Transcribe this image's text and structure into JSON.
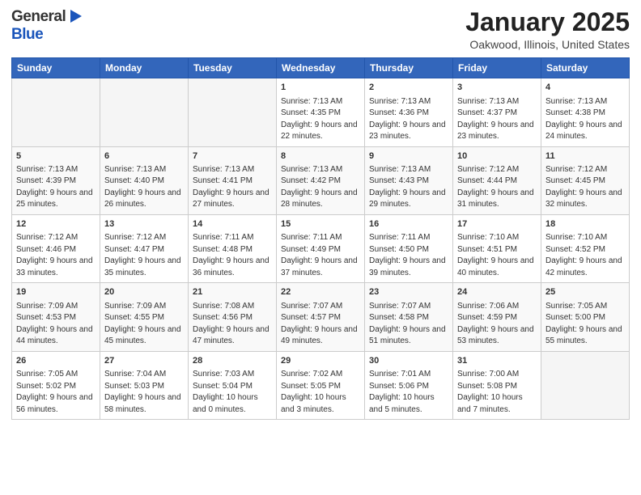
{
  "header": {
    "logo_general": "General",
    "logo_blue": "Blue",
    "title": "January 2025",
    "subtitle": "Oakwood, Illinois, United States"
  },
  "calendar": {
    "days_of_week": [
      "Sunday",
      "Monday",
      "Tuesday",
      "Wednesday",
      "Thursday",
      "Friday",
      "Saturday"
    ],
    "weeks": [
      [
        {
          "day": "",
          "info": ""
        },
        {
          "day": "",
          "info": ""
        },
        {
          "day": "",
          "info": ""
        },
        {
          "day": "1",
          "info": "Sunrise: 7:13 AM\nSunset: 4:35 PM\nDaylight: 9 hours and 22 minutes."
        },
        {
          "day": "2",
          "info": "Sunrise: 7:13 AM\nSunset: 4:36 PM\nDaylight: 9 hours and 23 minutes."
        },
        {
          "day": "3",
          "info": "Sunrise: 7:13 AM\nSunset: 4:37 PM\nDaylight: 9 hours and 23 minutes."
        },
        {
          "day": "4",
          "info": "Sunrise: 7:13 AM\nSunset: 4:38 PM\nDaylight: 9 hours and 24 minutes."
        }
      ],
      [
        {
          "day": "5",
          "info": "Sunrise: 7:13 AM\nSunset: 4:39 PM\nDaylight: 9 hours and 25 minutes."
        },
        {
          "day": "6",
          "info": "Sunrise: 7:13 AM\nSunset: 4:40 PM\nDaylight: 9 hours and 26 minutes."
        },
        {
          "day": "7",
          "info": "Sunrise: 7:13 AM\nSunset: 4:41 PM\nDaylight: 9 hours and 27 minutes."
        },
        {
          "day": "8",
          "info": "Sunrise: 7:13 AM\nSunset: 4:42 PM\nDaylight: 9 hours and 28 minutes."
        },
        {
          "day": "9",
          "info": "Sunrise: 7:13 AM\nSunset: 4:43 PM\nDaylight: 9 hours and 29 minutes."
        },
        {
          "day": "10",
          "info": "Sunrise: 7:12 AM\nSunset: 4:44 PM\nDaylight: 9 hours and 31 minutes."
        },
        {
          "day": "11",
          "info": "Sunrise: 7:12 AM\nSunset: 4:45 PM\nDaylight: 9 hours and 32 minutes."
        }
      ],
      [
        {
          "day": "12",
          "info": "Sunrise: 7:12 AM\nSunset: 4:46 PM\nDaylight: 9 hours and 33 minutes."
        },
        {
          "day": "13",
          "info": "Sunrise: 7:12 AM\nSunset: 4:47 PM\nDaylight: 9 hours and 35 minutes."
        },
        {
          "day": "14",
          "info": "Sunrise: 7:11 AM\nSunset: 4:48 PM\nDaylight: 9 hours and 36 minutes."
        },
        {
          "day": "15",
          "info": "Sunrise: 7:11 AM\nSunset: 4:49 PM\nDaylight: 9 hours and 37 minutes."
        },
        {
          "day": "16",
          "info": "Sunrise: 7:11 AM\nSunset: 4:50 PM\nDaylight: 9 hours and 39 minutes."
        },
        {
          "day": "17",
          "info": "Sunrise: 7:10 AM\nSunset: 4:51 PM\nDaylight: 9 hours and 40 minutes."
        },
        {
          "day": "18",
          "info": "Sunrise: 7:10 AM\nSunset: 4:52 PM\nDaylight: 9 hours and 42 minutes."
        }
      ],
      [
        {
          "day": "19",
          "info": "Sunrise: 7:09 AM\nSunset: 4:53 PM\nDaylight: 9 hours and 44 minutes."
        },
        {
          "day": "20",
          "info": "Sunrise: 7:09 AM\nSunset: 4:55 PM\nDaylight: 9 hours and 45 minutes."
        },
        {
          "day": "21",
          "info": "Sunrise: 7:08 AM\nSunset: 4:56 PM\nDaylight: 9 hours and 47 minutes."
        },
        {
          "day": "22",
          "info": "Sunrise: 7:07 AM\nSunset: 4:57 PM\nDaylight: 9 hours and 49 minutes."
        },
        {
          "day": "23",
          "info": "Sunrise: 7:07 AM\nSunset: 4:58 PM\nDaylight: 9 hours and 51 minutes."
        },
        {
          "day": "24",
          "info": "Sunrise: 7:06 AM\nSunset: 4:59 PM\nDaylight: 9 hours and 53 minutes."
        },
        {
          "day": "25",
          "info": "Sunrise: 7:05 AM\nSunset: 5:00 PM\nDaylight: 9 hours and 55 minutes."
        }
      ],
      [
        {
          "day": "26",
          "info": "Sunrise: 7:05 AM\nSunset: 5:02 PM\nDaylight: 9 hours and 56 minutes."
        },
        {
          "day": "27",
          "info": "Sunrise: 7:04 AM\nSunset: 5:03 PM\nDaylight: 9 hours and 58 minutes."
        },
        {
          "day": "28",
          "info": "Sunrise: 7:03 AM\nSunset: 5:04 PM\nDaylight: 10 hours and 0 minutes."
        },
        {
          "day": "29",
          "info": "Sunrise: 7:02 AM\nSunset: 5:05 PM\nDaylight: 10 hours and 3 minutes."
        },
        {
          "day": "30",
          "info": "Sunrise: 7:01 AM\nSunset: 5:06 PM\nDaylight: 10 hours and 5 minutes."
        },
        {
          "day": "31",
          "info": "Sunrise: 7:00 AM\nSunset: 5:08 PM\nDaylight: 10 hours and 7 minutes."
        },
        {
          "day": "",
          "info": ""
        }
      ]
    ]
  }
}
